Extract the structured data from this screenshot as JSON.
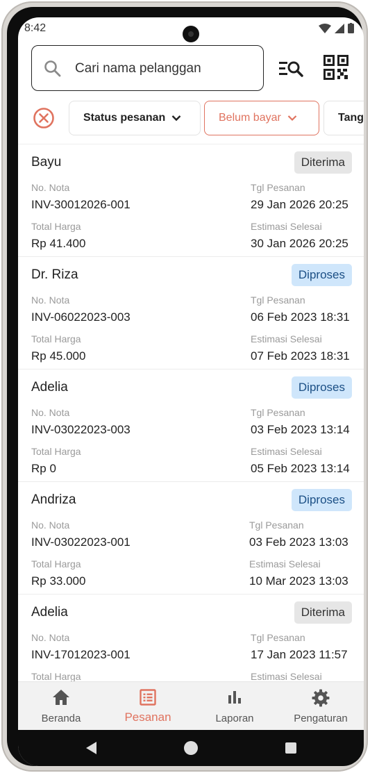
{
  "status_bar": {
    "time": "8:42"
  },
  "search": {
    "placeholder": "Cari nama pelanggan"
  },
  "filters": {
    "status_label": "Status pesanan",
    "unpaid_label": "Belum bayar",
    "date_label": "Tanggal"
  },
  "labels": {
    "invoice": "No. Nota",
    "order_date": "Tgl Pesanan",
    "total": "Total Harga",
    "estimate": "Estimasi Selesai"
  },
  "orders": [
    {
      "name": "Bayu",
      "status": "Diterima",
      "invoice": "INV-30012026-001",
      "order_date": "29 Jan 2026 20:25",
      "total": "Rp 41.400",
      "estimate": "30 Jan 2026 20:25"
    },
    {
      "name": "Dr. Riza",
      "status": "Diproses",
      "invoice": "INV-06022023-003",
      "order_date": "06 Feb 2023 18:31",
      "total": "Rp 45.000",
      "estimate": "07 Feb 2023 18:31"
    },
    {
      "name": "Adelia",
      "status": "Diproses",
      "invoice": "INV-03022023-003",
      "order_date": "03 Feb 2023 13:14",
      "total": "Rp 0",
      "estimate": "05 Feb 2023 13:14"
    },
    {
      "name": "Andriza",
      "status": "Diproses",
      "invoice": "INV-03022023-001",
      "order_date": "03 Feb 2023 13:03",
      "total": "Rp 33.000",
      "estimate": "10 Mar 2023 13:03"
    },
    {
      "name": "Adelia",
      "status": "Diterima",
      "invoice": "INV-17012023-001",
      "order_date": "17 Jan 2023 11:57",
      "total": "",
      "estimate": ""
    }
  ],
  "nav": {
    "home": "Beranda",
    "orders": "Pesanan",
    "reports": "Laporan",
    "settings": "Pengaturan"
  },
  "colors": {
    "accent": "#e0735f",
    "badge_grey": "#e6e6e6",
    "badge_blue": "#cfe6fb"
  },
  "icons": [
    "search-icon",
    "list-search-icon",
    "qr-code-icon",
    "clear-filter-icon",
    "chevron-down-icon",
    "home-icon",
    "orders-icon",
    "chart-icon",
    "gear-icon"
  ]
}
